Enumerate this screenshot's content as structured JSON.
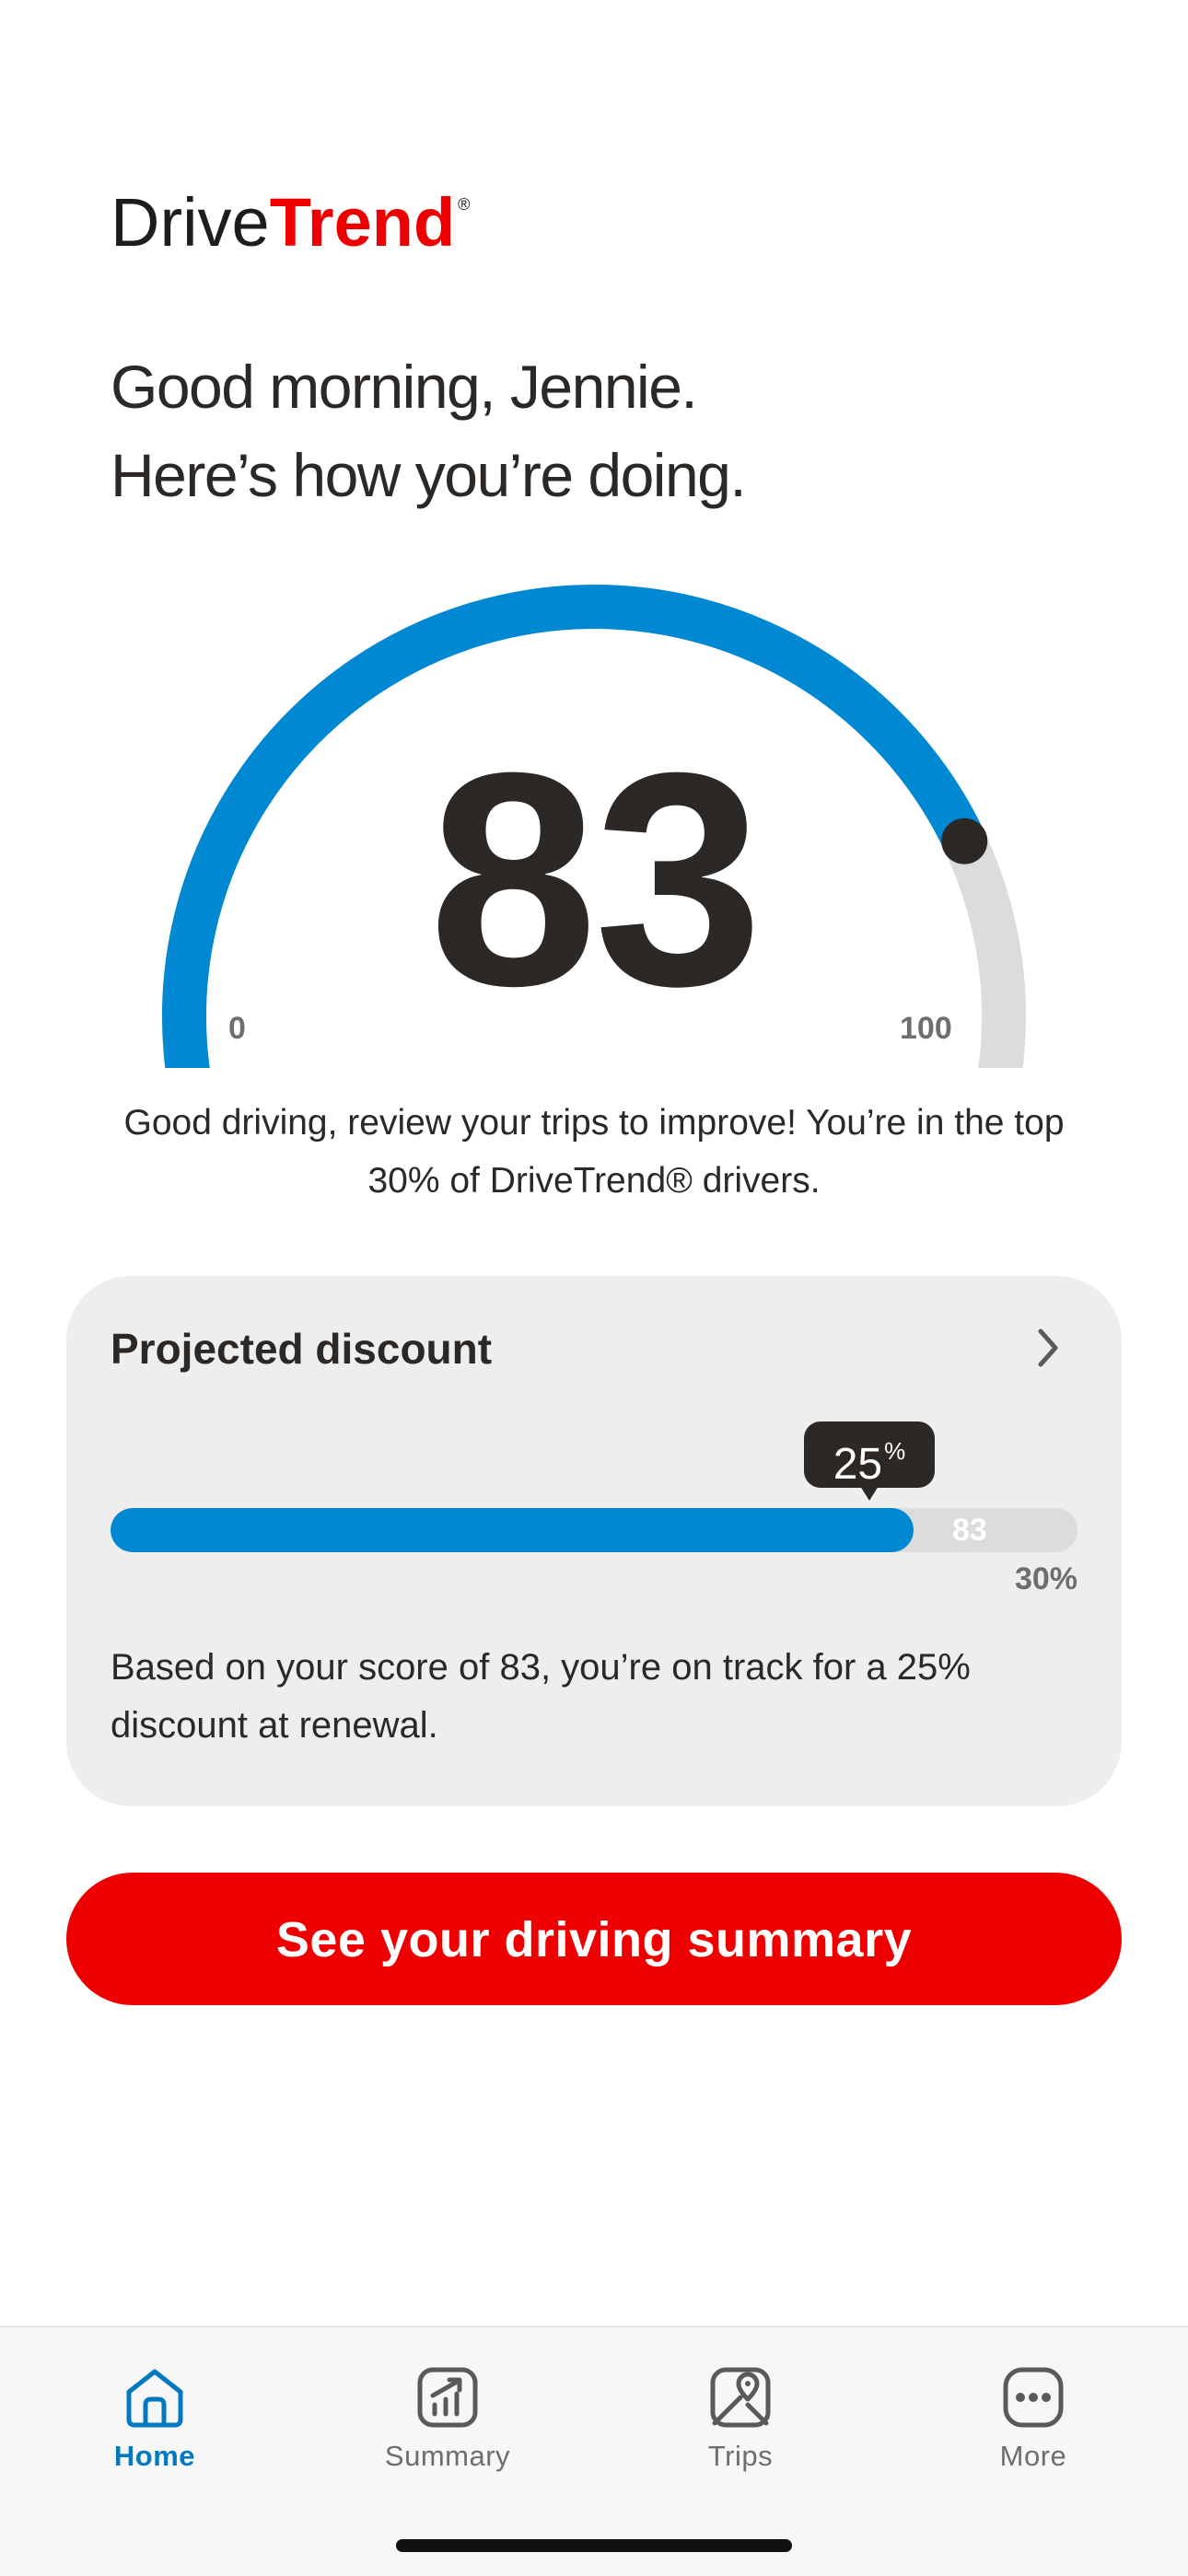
{
  "brand": {
    "part1": "Drive",
    "part2": "Trend",
    "reg": "®"
  },
  "greeting": {
    "line1": "Good morning, Jennie.",
    "line2": "Here’s how you’re doing."
  },
  "gauge": {
    "score": "83",
    "min_label": "0",
    "max_label": "100",
    "value": 83,
    "max": 100,
    "fill_color": "#0088d2",
    "track_color": "#dcdcdc"
  },
  "message": "Good driving, review your trips to improve! You’re in the top 30% of DriveTrend® drivers.",
  "discount_card": {
    "title": "Projected discount",
    "tooltip_value": "25",
    "tooltip_unit": "%",
    "bar_score": "83",
    "bar_max": "30%",
    "fill_fraction": 0.83,
    "description": "Based on your score of 83, you’re on track for a 25% discount at renewal."
  },
  "cta": {
    "label": "See your driving summary",
    "color": "#ee0000"
  },
  "tabs": [
    {
      "label": "Home",
      "icon": "home-icon",
      "active": true
    },
    {
      "label": "Summary",
      "icon": "chart-icon",
      "active": false
    },
    {
      "label": "Trips",
      "icon": "map-pin-icon",
      "active": false
    },
    {
      "label": "More",
      "icon": "more-icon",
      "active": false
    }
  ],
  "colors": {
    "accent": "#0088d2",
    "brand_red": "#ee0000",
    "text": "#2b2826"
  }
}
